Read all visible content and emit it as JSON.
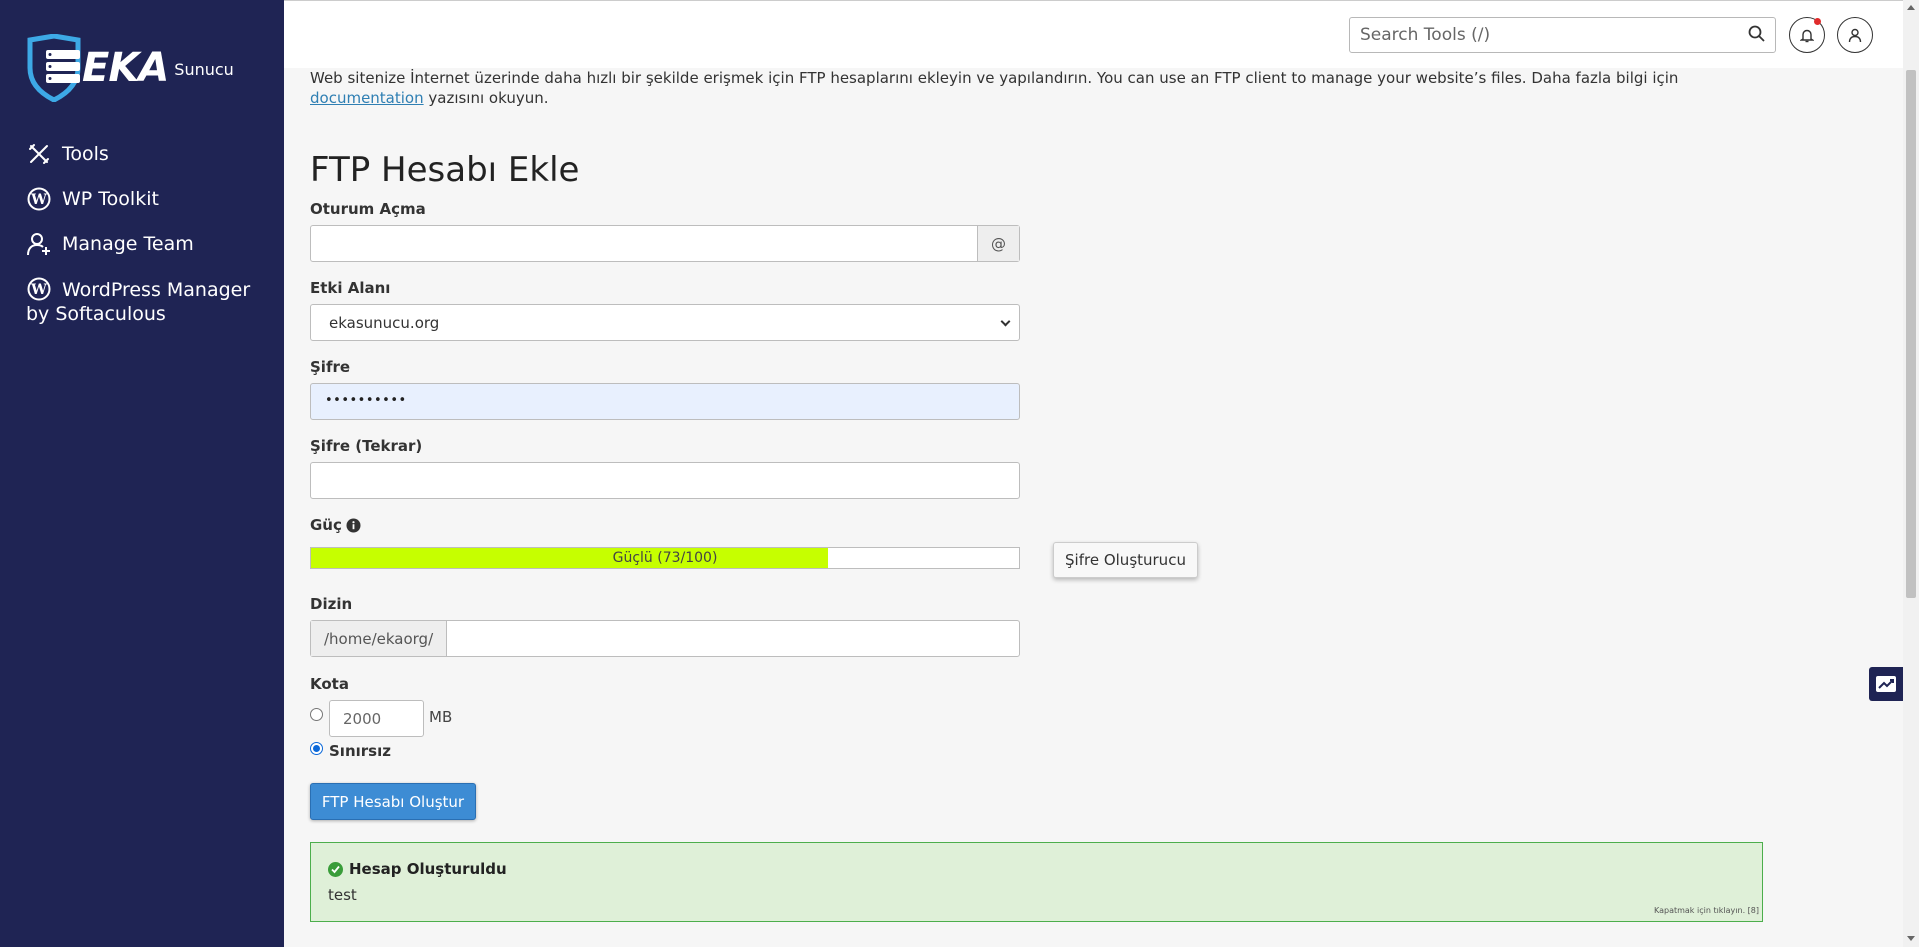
{
  "brand": {
    "name": "EKA",
    "sub": "Sunucu"
  },
  "sidebar": {
    "items": [
      {
        "label": "Tools"
      },
      {
        "label": "WP Toolkit"
      },
      {
        "label": "Manage Team"
      },
      {
        "label": "WordPress Manager by Softaculous"
      }
    ]
  },
  "header": {
    "search_placeholder": "Search Tools (/)"
  },
  "intro": {
    "text": "Web sitenize İnternet üzerinde daha hızlı bir şekilde erişmek için FTP hesaplarını ekleyin ve yapılandırın. You can use an FTP client to manage your website’s files. Daha fazla bilgi için ",
    "link": "documentation",
    "text_after": " yazısını okuyun."
  },
  "form": {
    "title": "FTP Hesabı Ekle",
    "login_label": "Oturum Açma",
    "login_value": "",
    "at_symbol": "@",
    "domain_label": "Etki Alanı",
    "domain_value": "ekasunucu.org",
    "password_label": "Şifre",
    "password_value": "••••••••••",
    "password_repeat_label": "Şifre (Tekrar)",
    "password_repeat_value": "",
    "strength_label": "Güç",
    "strength_text": "Güçlü (73/100)",
    "strength_value": 73,
    "strength_color": "#c6ff00",
    "generator_button": "Şifre Oluşturucu",
    "directory_label": "Dizin",
    "directory_prefix": "/home/ekaorg/",
    "directory_value": "",
    "quota_label": "Kota",
    "quota_value": "2000",
    "quota_unit": "MB",
    "unlimited_label": "Sınırsız",
    "submit_button": "FTP Hesabı Oluştur"
  },
  "alert": {
    "title": "Hesap Oluşturuldu",
    "body": "test",
    "close_hint": "Kapatmak için tıklayın. [8]"
  }
}
